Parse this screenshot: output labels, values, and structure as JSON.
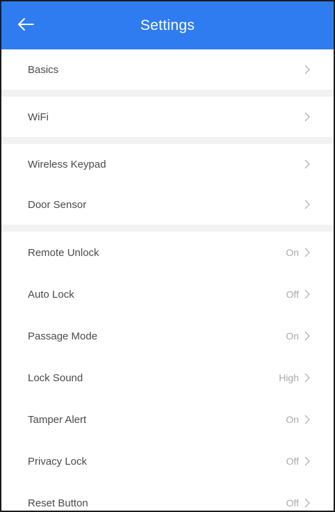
{
  "header": {
    "title": "Settings",
    "back_icon": "arrow-left-icon",
    "color": "#2f7cf0"
  },
  "sections": [
    {
      "items": [
        {
          "label": "Basics",
          "value": ""
        }
      ]
    },
    {
      "items": [
        {
          "label": "WiFi",
          "value": ""
        }
      ]
    },
    {
      "items": [
        {
          "label": "Wireless Keypad",
          "value": ""
        },
        {
          "label": "Door Sensor",
          "value": ""
        }
      ]
    },
    {
      "items": [
        {
          "label": "Remote Unlock",
          "value": "On"
        },
        {
          "label": "Auto Lock",
          "value": "Off"
        },
        {
          "label": "Passage Mode",
          "value": "On"
        },
        {
          "label": "Lock Sound",
          "value": "High"
        },
        {
          "label": "Tamper Alert",
          "value": "On"
        },
        {
          "label": "Privacy Lock",
          "value": "Off"
        },
        {
          "label": "Reset Button",
          "value": "Off"
        }
      ]
    }
  ],
  "chevron_icon": "chevron-right-icon"
}
